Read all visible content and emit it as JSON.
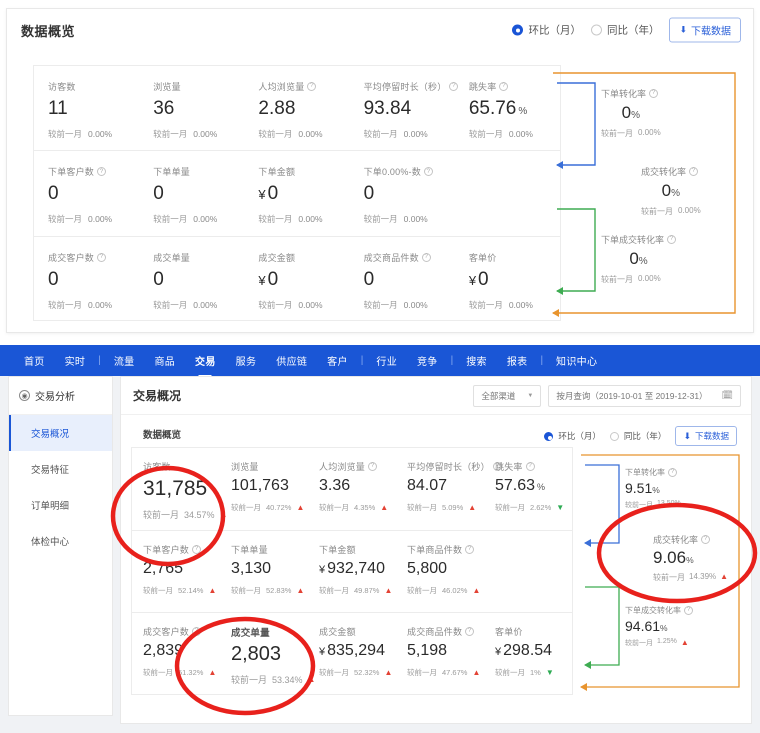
{
  "top_panel": {
    "title": "数据概览",
    "compare_options": [
      {
        "label": "环比（月）",
        "selected": true
      },
      {
        "label": "同比（年）",
        "selected": false
      }
    ],
    "download_label": "下载数据",
    "download_icon": "download-icon",
    "metrics": [
      [
        {
          "label": "访客数",
          "help": false,
          "value": "11",
          "unit": "",
          "delta_label": "较前一月",
          "delta": "0.00%",
          "trend": "none"
        },
        {
          "label": "浏览量",
          "help": false,
          "value": "36",
          "unit": "",
          "delta_label": "较前一月",
          "delta": "0.00%",
          "trend": "none"
        },
        {
          "label": "人均浏览量",
          "help": true,
          "value": "2.88",
          "unit": "",
          "delta_label": "较前一月",
          "delta": "0.00%",
          "trend": "none"
        },
        {
          "label": "平均停留时长（秒）",
          "help": true,
          "value": "93.84",
          "unit": "",
          "delta_label": "较前一月",
          "delta": "0.00%",
          "trend": "none"
        },
        {
          "label": "跳失率",
          "help": true,
          "value": "65.76",
          "unit": "%",
          "delta_label": "较前一月",
          "delta": "0.00%",
          "trend": "none"
        }
      ],
      [
        {
          "label": "下单客户数",
          "help": true,
          "value": "0",
          "unit": "",
          "delta_label": "较前一月",
          "delta": "0.00%",
          "trend": "none"
        },
        {
          "label": "下单单量",
          "help": false,
          "value": "0",
          "unit": "",
          "delta_label": "较前一月",
          "delta": "0.00%",
          "trend": "none"
        },
        {
          "label": "下单金额",
          "help": false,
          "currency": "¥",
          "value": "0",
          "unit": "",
          "delta_label": "较前一月",
          "delta": "0.00%",
          "trend": "none"
        },
        {
          "label": "下单0.00%-数",
          "help": true,
          "value": "0",
          "unit": "",
          "delta_label": "较前一月",
          "delta": "0.00%",
          "trend": "none"
        },
        {
          "label": "",
          "help": false,
          "value": "",
          "unit": "",
          "delta_label": "",
          "delta": "",
          "trend": "none"
        }
      ],
      [
        {
          "label": "成交客户数",
          "help": true,
          "value": "0",
          "unit": "",
          "delta_label": "较前一月",
          "delta": "0.00%",
          "trend": "none"
        },
        {
          "label": "成交单量",
          "help": false,
          "value": "0",
          "unit": "",
          "delta_label": "较前一月",
          "delta": "0.00%",
          "trend": "none"
        },
        {
          "label": "成交金额",
          "help": false,
          "currency": "¥",
          "value": "0",
          "unit": "",
          "delta_label": "较前一月",
          "delta": "0.00%",
          "trend": "none"
        },
        {
          "label": "成交商品件数",
          "help": true,
          "value": "0",
          "unit": "",
          "delta_label": "较前一月",
          "delta": "0.00%",
          "trend": "none"
        },
        {
          "label": "客单价",
          "help": false,
          "currency": "¥",
          "value": "0",
          "unit": "",
          "delta_label": "较前一月",
          "delta": "0.00%",
          "trend": "none"
        }
      ]
    ],
    "funnel": [
      {
        "label": "下单转化率",
        "help": true,
        "value": "0",
        "unit": "%",
        "delta_label": "较前一月",
        "delta": "0.00%",
        "color": "#3a6fd8"
      },
      {
        "label": "成交转化率",
        "help": true,
        "value": "0",
        "unit": "%",
        "delta_label": "较前一月",
        "delta": "0.00%",
        "color": "#e8942e"
      },
      {
        "label": "下单成交转化率",
        "help": true,
        "value": "0",
        "unit": "%",
        "delta_label": "较前一月",
        "delta": "0.00%",
        "color": "#3eac52"
      }
    ]
  },
  "navbar": {
    "items": [
      {
        "label": "首页",
        "active": false
      },
      {
        "label": "实时",
        "active": false
      },
      {
        "sep": true
      },
      {
        "label": "流量",
        "active": false
      },
      {
        "label": "商品",
        "active": false
      },
      {
        "label": "交易",
        "active": true
      },
      {
        "label": "服务",
        "active": false
      },
      {
        "label": "供应链",
        "active": false
      },
      {
        "label": "客户",
        "active": false
      },
      {
        "sep": true
      },
      {
        "label": "行业",
        "active": false
      },
      {
        "label": "竞争",
        "active": false
      },
      {
        "sep": true
      },
      {
        "label": "搜索",
        "active": false
      },
      {
        "label": "报表",
        "active": false
      },
      {
        "sep": true
      },
      {
        "label": "知识中心",
        "active": false
      }
    ]
  },
  "sidebar": {
    "header": "交易分析",
    "header_icon": "analysis-icon",
    "items": [
      {
        "label": "交易概况",
        "active": true
      },
      {
        "label": "交易特征",
        "active": false
      },
      {
        "label": "订单明细",
        "active": false
      },
      {
        "label": "体检中心",
        "active": false
      }
    ]
  },
  "content": {
    "title": "交易概况",
    "channel_select": "全部渠道",
    "date_range": "按月查询（2019-10-01 至 2019-12-31）",
    "calendar_icon": "calendar-icon",
    "subtitle": "数据概览",
    "compare_options": [
      {
        "label": "环比（月）",
        "selected": true
      },
      {
        "label": "同比（年）",
        "selected": false
      }
    ],
    "download_label": "下载数据",
    "metrics": [
      [
        {
          "label": "访客数",
          "help": false,
          "value": "31,785",
          "unit": "",
          "delta_label": "较前一月",
          "delta": "34.57%",
          "trend": "up"
        },
        {
          "label": "浏览量",
          "help": false,
          "value": "101,763",
          "unit": "",
          "delta_label": "较前一月",
          "delta": "40.72%",
          "trend": "up"
        },
        {
          "label": "人均浏览量",
          "help": true,
          "value": "3.36",
          "unit": "",
          "delta_label": "较前一月",
          "delta": "4.35%",
          "trend": "up"
        },
        {
          "label": "平均停留时长（秒）",
          "help": true,
          "value": "84.07",
          "unit": "",
          "delta_label": "较前一月",
          "delta": "5.09%",
          "trend": "up"
        },
        {
          "label": "跳失率",
          "help": true,
          "value": "57.63",
          "unit": "%",
          "delta_label": "较前一月",
          "delta": "2.62%",
          "trend": "down"
        }
      ],
      [
        {
          "label": "下单客户数",
          "help": true,
          "value": "2,765",
          "unit": "",
          "delta_label": "较前一月",
          "delta": "52.14%",
          "trend": "up"
        },
        {
          "label": "下单单量",
          "help": false,
          "value": "3,130",
          "unit": "",
          "delta_label": "较前一月",
          "delta": "52.83%",
          "trend": "up"
        },
        {
          "label": "下单金额",
          "help": false,
          "currency": "¥",
          "value": "932,740",
          "unit": "",
          "delta_label": "较前一月",
          "delta": "49.87%",
          "trend": "up"
        },
        {
          "label": "下单商品件数",
          "help": true,
          "value": "5,800",
          "unit": "",
          "delta_label": "较前一月",
          "delta": "46.02%",
          "trend": "up"
        },
        {
          "label": "",
          "help": false,
          "value": "",
          "unit": "",
          "delta_label": "",
          "delta": "",
          "trend": "none"
        }
      ],
      [
        {
          "label": "成交客户数",
          "help": true,
          "value": "2,839",
          "unit": "",
          "delta_label": "较前一月",
          "delta": "51.32%",
          "trend": "up"
        },
        {
          "label": "成交单量",
          "help": false,
          "value": "2,803",
          "unit": "",
          "delta_label": "较前一月",
          "delta": "53.34%",
          "trend": "up"
        },
        {
          "label": "成交金额",
          "help": false,
          "currency": "¥",
          "value": "835,294",
          "unit": "",
          "delta_label": "较前一月",
          "delta": "52.32%",
          "trend": "up"
        },
        {
          "label": "成交商品件数",
          "help": true,
          "value": "5,198",
          "unit": "",
          "delta_label": "较前一月",
          "delta": "47.67%",
          "trend": "up"
        },
        {
          "label": "客单价",
          "help": false,
          "currency": "¥",
          "value": "298.54",
          "unit": "",
          "delta_label": "较前一月",
          "delta": "1%",
          "trend": "down"
        }
      ]
    ],
    "funnel": [
      {
        "label": "下单转化率",
        "help": true,
        "value": "9.51",
        "unit": "%",
        "delta_label": "较前一月",
        "delta": "13.50%",
        "color": "#3a6fd8"
      },
      {
        "label": "成交转化率",
        "help": true,
        "value": "9.06",
        "unit": "%",
        "delta_label": "较前一月",
        "delta": "14.39%",
        "color": "#e8942e"
      },
      {
        "label": "下单成交转化率",
        "help": true,
        "value": "94.61",
        "unit": "%",
        "delta_label": "较前一月",
        "delta": "1.25%",
        "color": "#3eac52"
      }
    ]
  },
  "annotations": {
    "color": "#e8211c",
    "circles": [
      "visitors-metric",
      "transaction-orders-metric",
      "conversion-rate-metric"
    ]
  },
  "icons": {
    "arrow_up": "▲",
    "arrow_down": "▼",
    "help": "?",
    "caret_down": "▼",
    "download": "⬇"
  }
}
